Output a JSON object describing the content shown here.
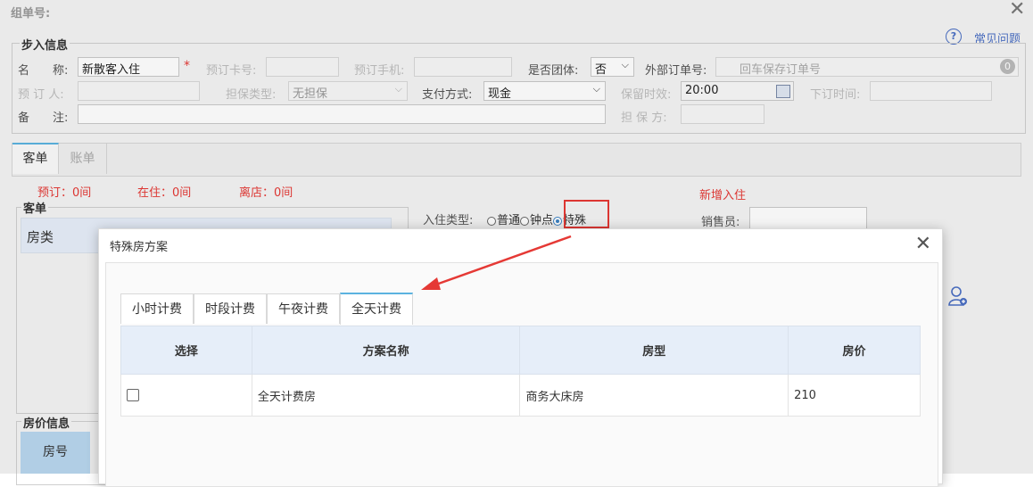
{
  "header": {
    "title": "组单号:",
    "help_label": "常见问题"
  },
  "step_section": {
    "legend": "步入信息"
  },
  "form": {
    "name_label": "名　　称:",
    "name_value": "新散客入住",
    "card_label": "预订卡号:",
    "phone_label": "预订手机:",
    "group_label": "是否团体:",
    "group_value": "否",
    "ext_order_label": "外部订单号:",
    "ext_order_placeholder": "回车保存订单号",
    "booker_label": "预 订 人:",
    "guarantee_type_label": "担保类型:",
    "guarantee_type_value": "无担保",
    "pay_label": "支付方式:",
    "pay_value": "现金",
    "retain_label": "保留时效:",
    "retain_value": "20:00",
    "next_order_label": "下订时间:",
    "note_label": "备　　注:",
    "guarantor_label": "担 保 方:"
  },
  "tabs_main": [
    {
      "label": "客单"
    },
    {
      "label": "账单"
    }
  ],
  "stats": {
    "booked": "预订：0间",
    "staying": "在住：0间",
    "left": "离店：0间",
    "new_checkin": "新增入住"
  },
  "guest_section": {
    "legend": "客单",
    "room_type_header": "房类",
    "checkin_type_label": "入住类型:",
    "checkin_options": [
      "普通",
      "钟点",
      "特殊"
    ],
    "sales_label": "销售员:"
  },
  "price_section": {
    "legend": "房价信息",
    "room_no_header": "房号"
  },
  "modal": {
    "title": "特殊房方案",
    "tabs": [
      {
        "label": "小时计费"
      },
      {
        "label": "时段计费"
      },
      {
        "label": "午夜计费"
      },
      {
        "label": "全天计费"
      }
    ],
    "columns": [
      "选择",
      "方案名称",
      "房型",
      "房价"
    ],
    "rows": [
      {
        "plan": "全天计费房",
        "room_type": "商务大床房",
        "price": "210"
      }
    ]
  },
  "colors": {
    "accent_red": "#e53935",
    "tab_active": "#5bb3e0",
    "header_blue": "#e6eef9"
  }
}
